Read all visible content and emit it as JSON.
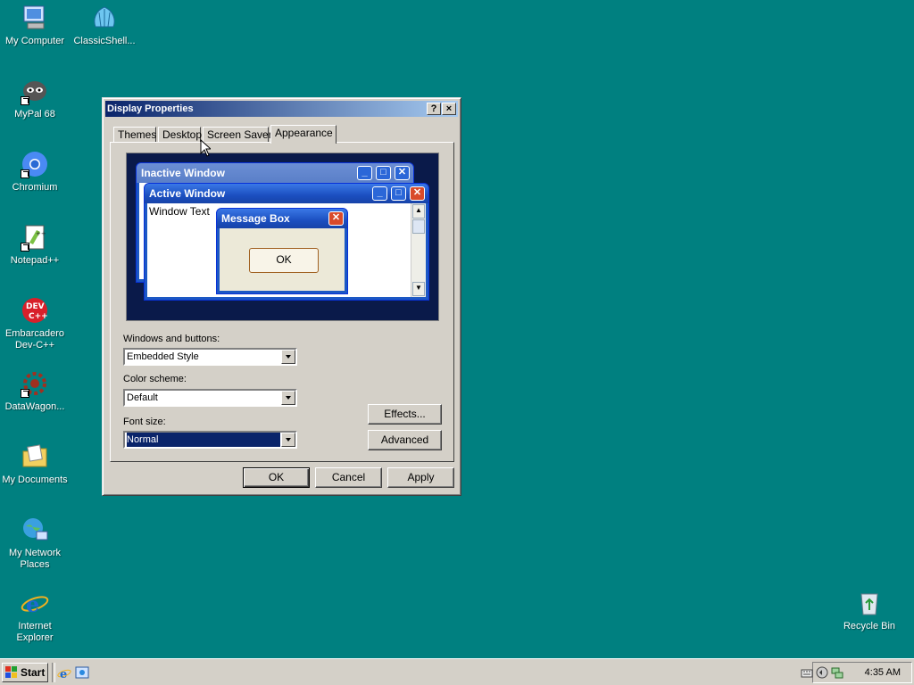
{
  "desktop": {
    "icons": [
      {
        "label": "My Computer",
        "icon": "my-computer-icon"
      },
      {
        "label": "ClassicShell...",
        "icon": "classic-shell-icon"
      },
      {
        "label": "MyPal 68",
        "icon": "mypal-icon"
      },
      {
        "label": "Chromium",
        "icon": "chromium-icon"
      },
      {
        "label": "Notepad++",
        "icon": "notepadpp-icon"
      },
      {
        "label": "Embarcadero Dev-C++",
        "icon": "devcpp-icon"
      },
      {
        "label": "DataWagon...",
        "icon": "datawagon-icon"
      },
      {
        "label": "My Documents",
        "icon": "my-documents-icon"
      },
      {
        "label": "My Network Places",
        "icon": "network-places-icon"
      },
      {
        "label": "Internet Explorer",
        "icon": "internet-explorer-icon"
      },
      {
        "label": "Recycle Bin",
        "icon": "recycle-bin-icon"
      }
    ]
  },
  "dialog": {
    "title": "Display Properties",
    "help_btn": "?",
    "close_btn": "×",
    "tabs": [
      "Themes",
      "Desktop",
      "Screen Saver",
      "Appearance"
    ],
    "active_tab": "Appearance",
    "preview": {
      "inactive_title": "Inactive Window",
      "active_title": "Active Window",
      "window_text": "Window Text",
      "msgbox_title": "Message Box",
      "msgbox_ok": "OK"
    },
    "windows_buttons_label": "Windows and buttons:",
    "windows_buttons_value": "Embedded Style",
    "color_scheme_label": "Color scheme:",
    "color_scheme_value": "Default",
    "font_size_label": "Font size:",
    "font_size_value": "Normal",
    "effects_btn": "Effects...",
    "advanced_btn": "Advanced",
    "ok_btn": "OK",
    "cancel_btn": "Cancel",
    "apply_btn": "Apply"
  },
  "taskbar": {
    "start_label": "Start",
    "clock": "4:35 AM"
  },
  "colors": {
    "desktop": "#008080",
    "title_active": "#0a246a",
    "face": "#d4d0c8"
  }
}
